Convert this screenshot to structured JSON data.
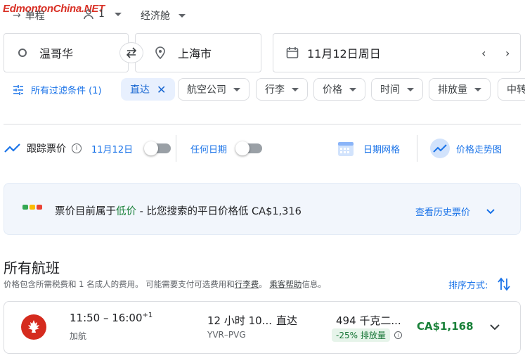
{
  "watermark": "EdmontonChina.NET",
  "topbar": {
    "trip_type": "单程",
    "passengers": "1",
    "cabin": "经济舱"
  },
  "search": {
    "origin": "温哥华",
    "destination": "上海市",
    "date": "11月12日周日"
  },
  "filters": {
    "all_filters": "所有过滤条件 (1)",
    "chips": [
      "直达",
      "航空公司",
      "行李",
      "价格",
      "时间",
      "排放量",
      "中转"
    ]
  },
  "tracking": {
    "label": "跟踪票价",
    "date_label": "11月12日",
    "any_date_label": "任何日期",
    "date_grid": "日期网格",
    "price_graph": "价格走势图"
  },
  "insight": {
    "text_prefix": "票价目前属于",
    "text_low": "低价",
    "text_suffix": " - 比您搜索的平日价格低 CA$1,316",
    "history_link": "查看历史票价"
  },
  "results": {
    "title": "所有航班",
    "note_prefix": "价格包含所需税费和 1 名成人的费用。 可能需要支付可选费用和",
    "note_link1": "行李费",
    "note_mid": "。",
    "note_link2": "乘客帮助",
    "note_suffix": "信息。",
    "sort_label": "排序方式:"
  },
  "flights": [
    {
      "time": "11:50 – 16:00",
      "day_offset": "+1",
      "airline": "加航",
      "duration": "12 小时 10...",
      "stops": "直达",
      "route": "YVR–PVG",
      "emissions": "494 千克二...",
      "emissions_badge": "-25% 排放量",
      "price": "CA$1,168"
    }
  ],
  "colors": {
    "accent": "#1a73e8",
    "price_green": "#188038",
    "aircanada_red": "#d52b1e"
  }
}
